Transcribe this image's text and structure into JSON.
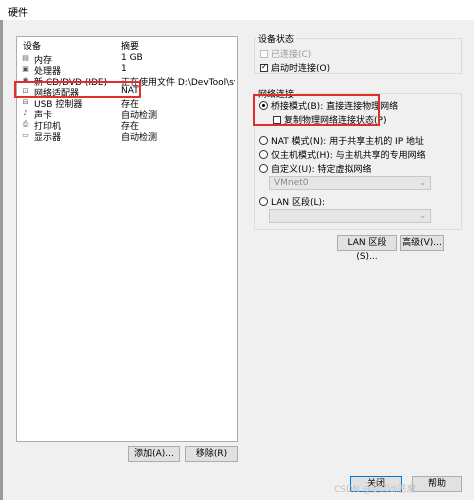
{
  "window": {
    "title": "硬件"
  },
  "device_list": {
    "columns": [
      "设备",
      "摘要"
    ],
    "rows": [
      {
        "icon": "memory-icon",
        "glyph": "▤",
        "name": "内存",
        "summary": "1 GB"
      },
      {
        "icon": "cpu-icon",
        "glyph": "▣",
        "name": "处理器",
        "summary": "1"
      },
      {
        "icon": "cd-icon",
        "glyph": "◉",
        "name": "新 CD/DVD (IDE)",
        "summary": "正在使用文件 D:\\DevTool\\syst..."
      },
      {
        "icon": "network-icon",
        "glyph": "⊡",
        "name": "网络适配器",
        "summary": "NAT"
      },
      {
        "icon": "usb-icon",
        "glyph": "⊟",
        "name": "USB 控制器",
        "summary": "存在"
      },
      {
        "icon": "sound-icon",
        "glyph": "♪",
        "name": "声卡",
        "summary": "自动检测"
      },
      {
        "icon": "printer-icon",
        "glyph": "⎙",
        "name": "打印机",
        "summary": "存在"
      },
      {
        "icon": "display-icon",
        "glyph": "▭",
        "name": "显示器",
        "summary": "自动检测"
      }
    ],
    "selected_index": 3,
    "add_label": "添加(A)...",
    "remove_label": "移除(R)"
  },
  "device_status": {
    "title": "设备状态",
    "connected": {
      "label": "已连接(C)",
      "checked": false,
      "enabled": false
    },
    "connect_at_power_on": {
      "label": "启动时连接(O)",
      "checked": true,
      "enabled": true
    }
  },
  "network": {
    "title": "网络连接",
    "bridged": {
      "label": "桥接模式(B): 直接连接物理网络",
      "selected": true
    },
    "replicate": {
      "label": "复制物理网络连接状态(P)",
      "checked": false
    },
    "nat": {
      "label": "NAT 模式(N): 用于共享主机的 IP 地址",
      "selected": false
    },
    "host_only": {
      "label": "仅主机模式(H): 与主机共享的专用网络",
      "selected": false
    },
    "custom": {
      "label": "自定义(U): 特定虚拟网络",
      "selected": false,
      "select_value": "VMnet0"
    },
    "lan_segment": {
      "label": "LAN 区段(L):",
      "selected": false,
      "select_value": ""
    },
    "lan_segments_button": "LAN 区段(S)...",
    "advanced_button": "高级(V)..."
  },
  "footer": {
    "close_label": "关闭",
    "help_label": "帮助"
  },
  "watermark": "CSDN @封印di恶魔"
}
